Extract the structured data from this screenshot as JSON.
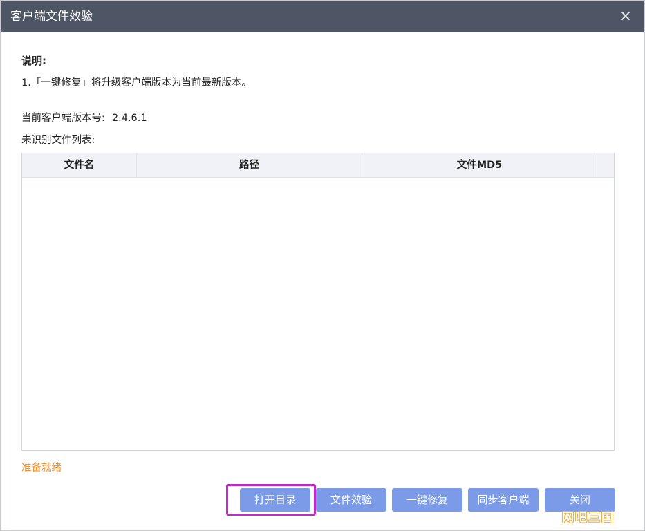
{
  "window": {
    "title": "客户端文件效验",
    "close_icon": "×"
  },
  "description": {
    "heading": "说明:",
    "line1": "1.「一键修复」将升级客户端版本为当前最新版本。"
  },
  "version": {
    "label": "当前客户端版本号:",
    "value": "2.4.6.1"
  },
  "unrecognized_list": {
    "label": "未识别文件列表:",
    "columns": [
      "文件名",
      "路径",
      "文件MD5"
    ],
    "rows": []
  },
  "status": {
    "text": "准备就绪",
    "color": "#f08c2a"
  },
  "buttons": {
    "open_dir": "打开目录",
    "file_check": "文件效验",
    "one_click_repair": "一键修复",
    "sync_client": "同步客户端",
    "close": "关闭"
  },
  "watermark": "网吧三国",
  "colors": {
    "titlebar": "#4e5666",
    "button": "#7b9be8",
    "highlight": "#c429c9"
  }
}
